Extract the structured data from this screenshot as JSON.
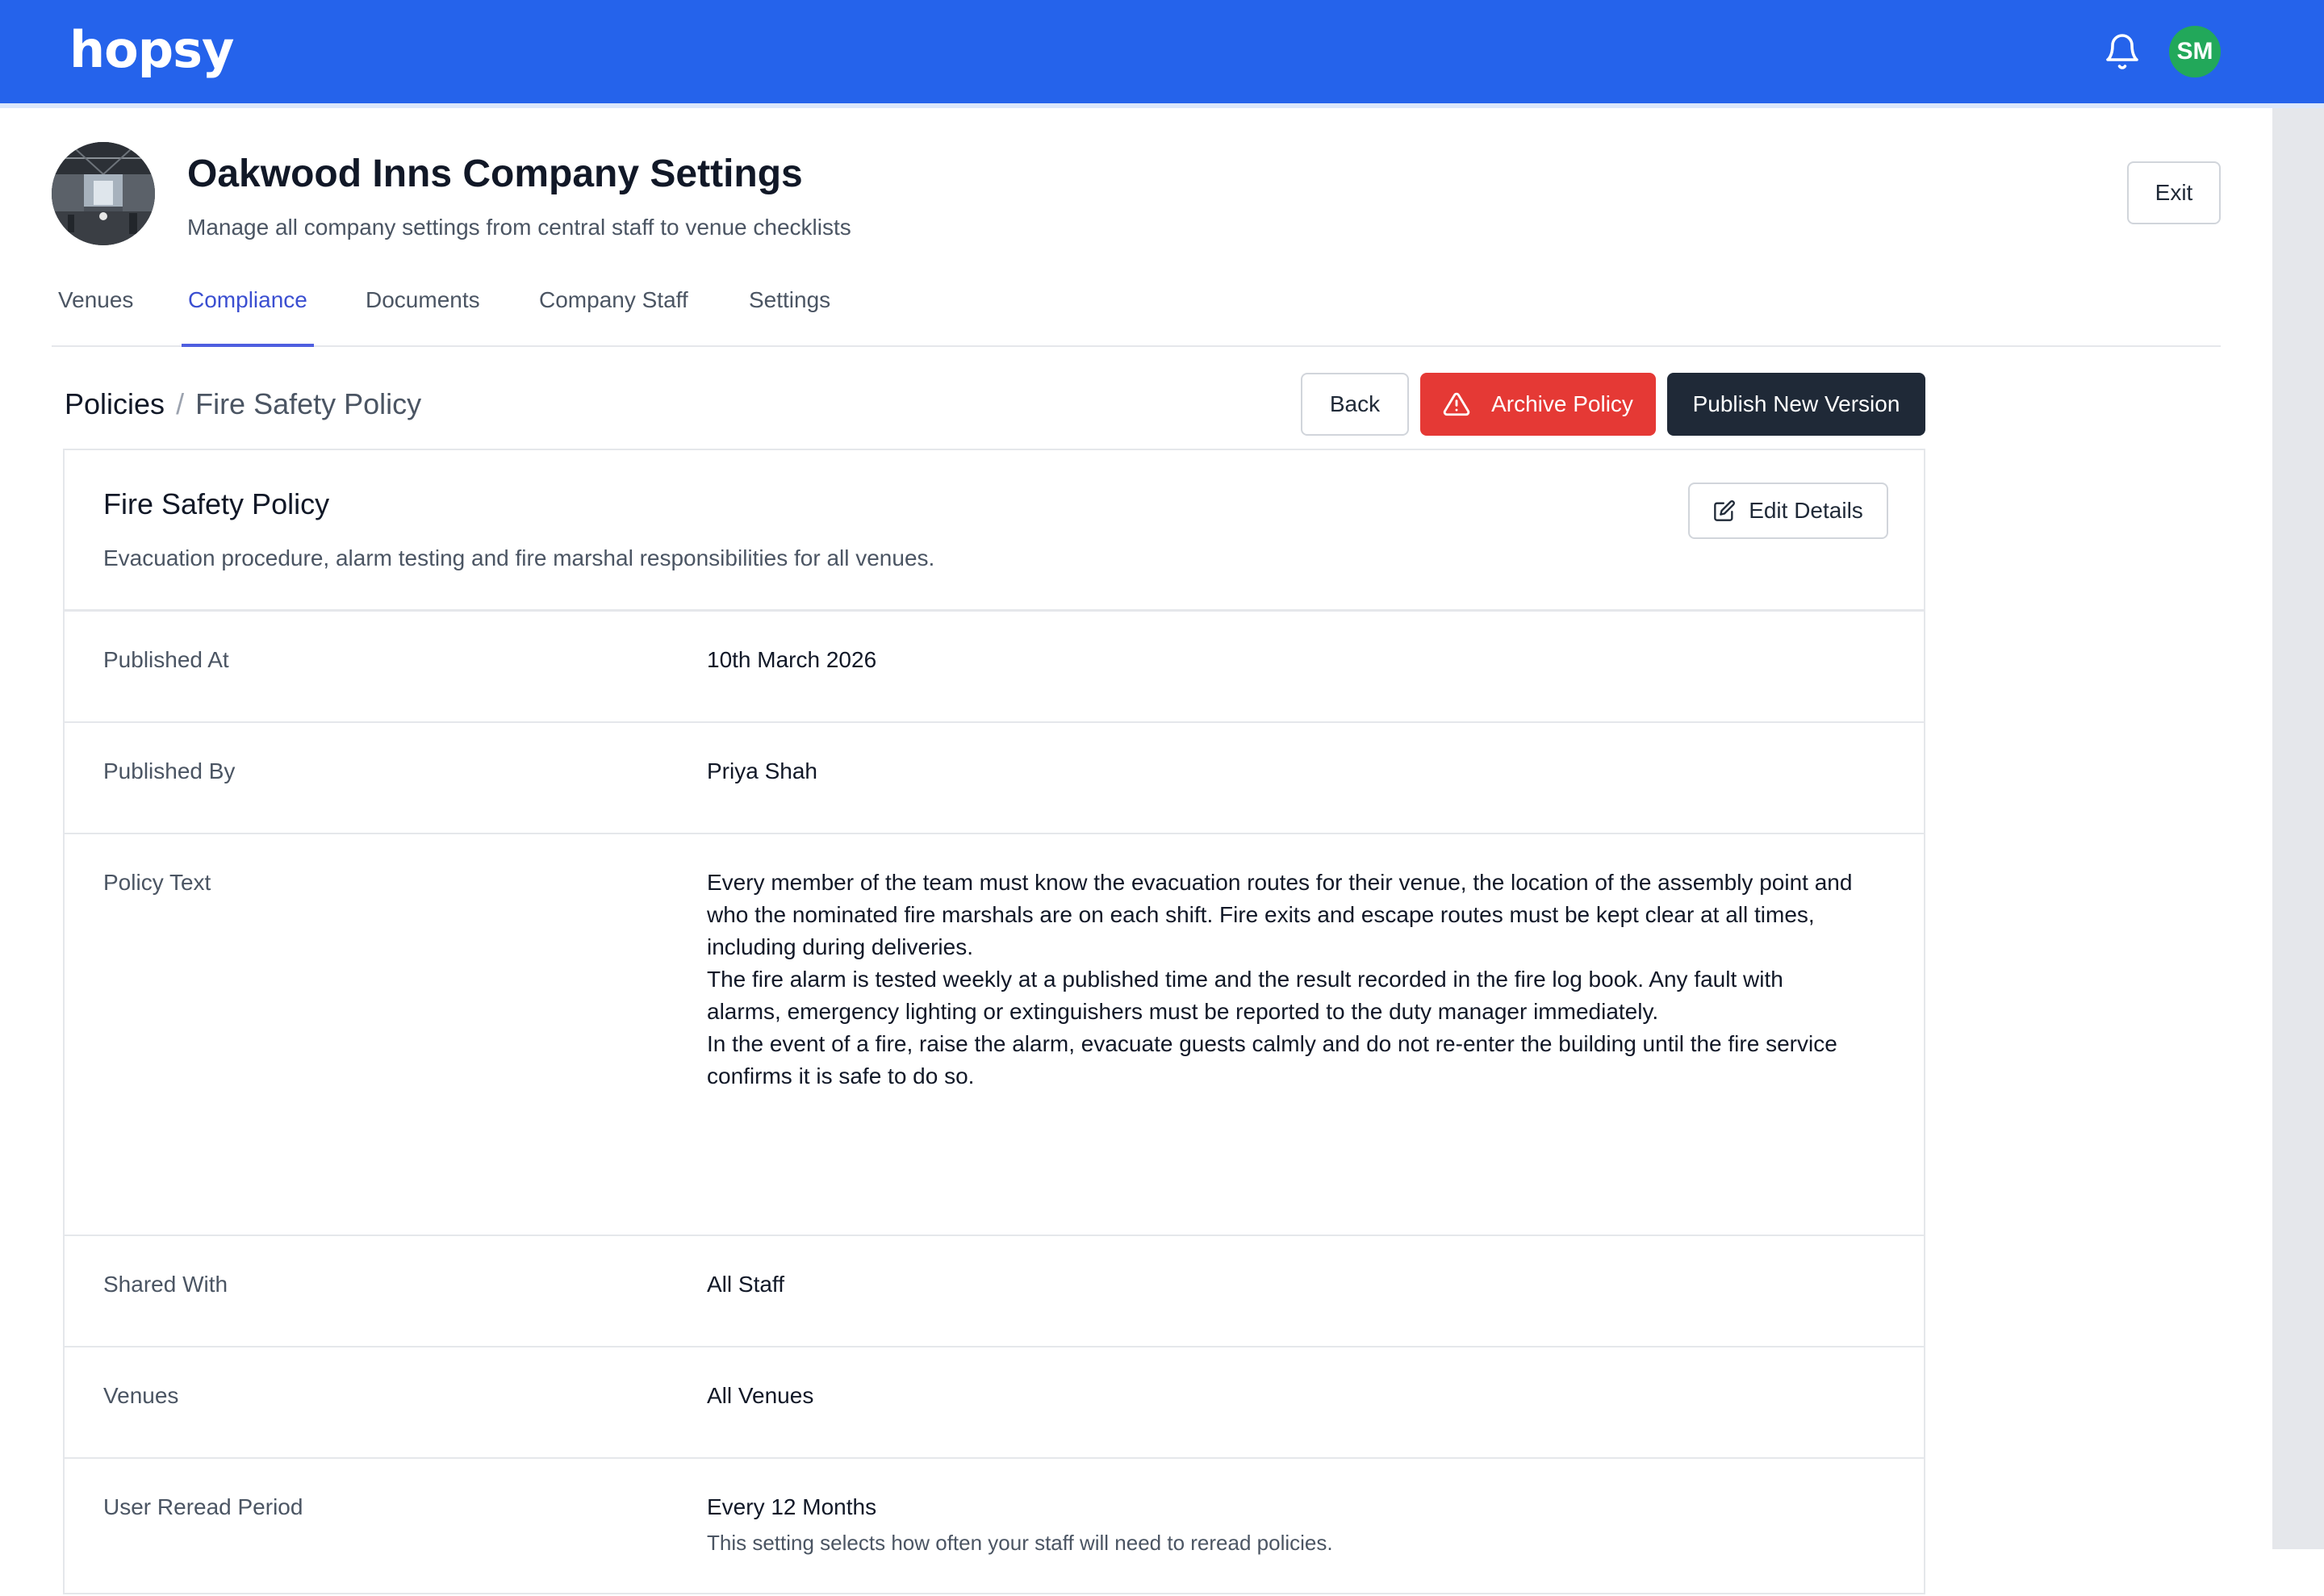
{
  "app": {
    "logo_text": "hopsy",
    "user_initials": "SM",
    "brand_color": "#2563eb",
    "avatar_color": "#22a85a"
  },
  "header": {
    "title": "Oakwood Inns Company Settings",
    "subtitle": "Manage all company settings from central staff to venue checklists",
    "exit_label": "Exit"
  },
  "tabs": [
    {
      "label": "Venues",
      "active": false
    },
    {
      "label": "Compliance",
      "active": true
    },
    {
      "label": "Documents",
      "active": false
    },
    {
      "label": "Company Staff",
      "active": false
    },
    {
      "label": "Settings",
      "active": false
    }
  ],
  "breadcrumb": {
    "root": "Policies",
    "separator": "/",
    "current": "Fire Safety Policy"
  },
  "actions": {
    "back_label": "Back",
    "archive_label": "Archive Policy",
    "publish_label": "Publish New Version",
    "archive_color": "#e53935",
    "publish_color": "#1f2937"
  },
  "policy": {
    "title": "Fire Safety Policy",
    "description": "Evacuation procedure, alarm testing and fire marshal responsibilities for all venues.",
    "edit_label": "Edit Details",
    "fields": {
      "published_at": {
        "label": "Published At",
        "value": "10th March 2026"
      },
      "published_by": {
        "label": "Published By",
        "value": "Priya Shah"
      },
      "policy_text": {
        "label": "Policy Text",
        "paragraphs": [
          "Every member of the team must know the evacuation routes for their venue, the location of the assembly point and who the nominated fire marshals are on each shift. Fire exits and escape routes must be kept clear at all times, including during deliveries.",
          "The fire alarm is tested weekly at a published time and the result recorded in the fire log book. Any fault with alarms, emergency lighting or extinguishers must be reported to the duty manager immediately.",
          "In the event of a fire, raise the alarm, evacuate guests calmly and do not re-enter the building until the fire service confirms it is safe to do so."
        ]
      },
      "shared_with": {
        "label": "Shared With",
        "value": "All Staff"
      },
      "venues": {
        "label": "Venues",
        "value": "All Venues"
      },
      "reread_period": {
        "label": "User Reread Period",
        "value": "Every 12 Months",
        "help": "This setting selects how often your staff will need to reread policies."
      }
    }
  },
  "icons": {
    "bell": "bell-icon",
    "warning": "warning-triangle-icon",
    "edit": "edit-icon"
  }
}
